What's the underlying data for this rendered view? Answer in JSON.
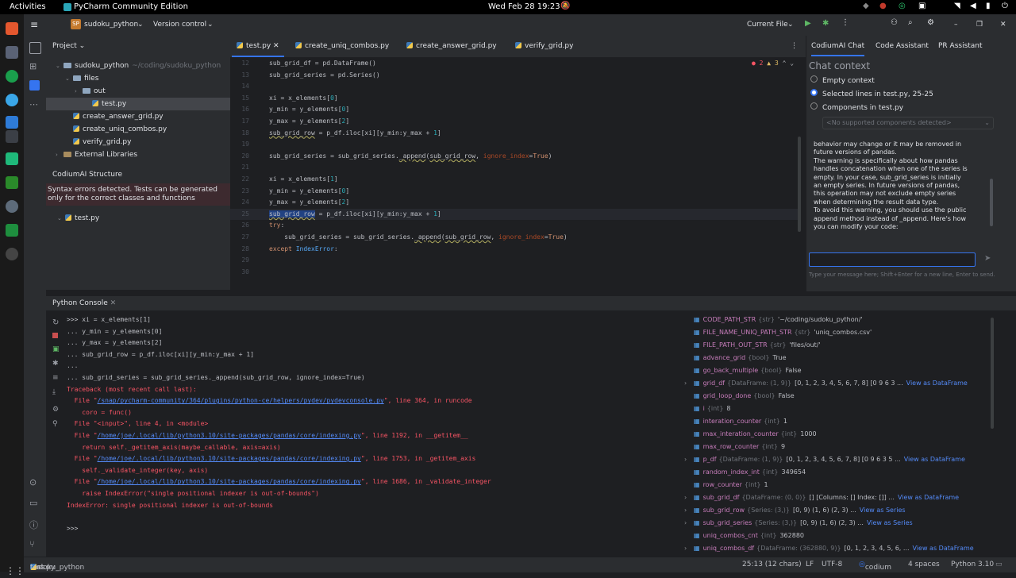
{
  "topbar": {
    "activities": "Activities",
    "app_name": "PyCharm Community Edition",
    "clock": "Wed Feb 28  19:23"
  },
  "dock_icons": [
    "brave-icon",
    "files-icon",
    "terminal-icon",
    "edge-icon",
    "vscode-icon",
    "code-icon",
    "pycharm-icon",
    "terminal2-icon",
    "spreadsheet-icon",
    "settings-icon",
    "more-apps-icon",
    "trash-icon"
  ],
  "toolbar": {
    "project_badge": "SP",
    "project_name": "sudoku_python",
    "vcs": "Version control",
    "run_config": "Current File"
  },
  "project": {
    "title": "Project",
    "tree": [
      {
        "label": "sudoku_python",
        "extra": "~/coding/sudoku_python",
        "indent": 0,
        "kind": "folder",
        "chev": "⌄"
      },
      {
        "label": "files",
        "indent": 1,
        "kind": "folder",
        "chev": "⌄"
      },
      {
        "label": "out",
        "indent": 2,
        "kind": "folder",
        "chev": "›"
      },
      {
        "label": "test.py",
        "indent": 3,
        "kind": "py",
        "selected": true
      },
      {
        "label": "create_answer_grid.py",
        "indent": 1,
        "kind": "py"
      },
      {
        "label": "create_uniq_combos.py",
        "indent": 1,
        "kind": "py"
      },
      {
        "label": "verify_grid.py",
        "indent": 1,
        "kind": "py"
      },
      {
        "label": "External Libraries",
        "indent": 0,
        "kind": "lib",
        "chev": "›"
      }
    ],
    "structure_title": "CodiumAI Structure",
    "structure_msg": "Syntax errors detected. Tests can be generated only for the correct classes and functions",
    "structure_file": "test.py"
  },
  "editor": {
    "tabs": [
      "test.py",
      "create_uniq_combos.py",
      "create_answer_grid.py",
      "verify_grid.py"
    ],
    "errors": "2",
    "warnings": "3",
    "lines": [
      {
        "n": "12",
        "html": "<span>sub_grid_df = pd.DataFrame()</span>"
      },
      {
        "n": "13",
        "html": "<span>sub_grid_series = pd.Series()</span>"
      },
      {
        "n": "14",
        "html": ""
      },
      {
        "n": "15",
        "html": "<span>xi = x_elements[<span class='num'>0</span>]</span>"
      },
      {
        "n": "16",
        "html": "<span>y_min = y_elements[<span class='num'>0</span>]</span>"
      },
      {
        "n": "17",
        "html": "<span>y_max = y_elements[<span class='num'>2</span>]</span>"
      },
      {
        "n": "18",
        "html": "<span class='warn'>sub_grid_row</span> = p_df.iloc[xi][y_min:y_max + <span class='num'>1</span>]"
      },
      {
        "n": "19",
        "html": ""
      },
      {
        "n": "20",
        "html": "sub_grid_series = sub_grid_series.<span class='warn'>_append</span>(<span class='warn'>sub_grid_row</span>, <span style='color:#aa4926'>ignore_index</span>=<span class='kw'>True</span>)"
      },
      {
        "n": "21",
        "html": ""
      },
      {
        "n": "22",
        "html": "xi = x_elements[<span class='num'>1</span>]"
      },
      {
        "n": "23",
        "html": "y_min = y_elements[<span class='num'>0</span>]"
      },
      {
        "n": "24",
        "html": "y_max = y_elements[<span class='num'>2</span>]"
      },
      {
        "n": "25",
        "html": "<span class='sel-hl warn'>sub_grid_row</span> = p_df.iloc[xi][y_min:y_max + <span class='num'>1</span>]",
        "current": true
      },
      {
        "n": "26",
        "html": "<span class='kw'>try</span>:"
      },
      {
        "n": "27",
        "html": "    sub_grid_series = sub_grid_series.<span class='warn'>_append</span>(<span class='warn'>sub_grid_row</span>, <span style='color:#aa4926'>ignore_index</span>=<span class='kw'>True</span>)"
      },
      {
        "n": "28",
        "html": "<span class='kw'>except</span> <span style='color:#56a8f5'>IndexError</span>:"
      },
      {
        "n": "29",
        "html": ""
      },
      {
        "n": "30",
        "html": ""
      }
    ]
  },
  "codium": {
    "tabs": [
      "CodiumAI Chat",
      "Code Assistant",
      "PR Assistant"
    ],
    "context_title": "Chat context",
    "options": [
      "Empty context",
      "Selected lines in test.py, 25-25",
      "Components in test.py"
    ],
    "selected_option": 1,
    "dropdown": "<No supported components detected>",
    "reply": [
      "behavior may change or it may be removed in",
      "future versions of pandas.",
      "The warning is specifically about how pandas",
      "handles concatenation when one of the series is",
      "empty. In your case, sub_grid_series is initially",
      "an empty series. In future versions of pandas,",
      "this operation may not exclude empty series",
      "when determining the result data type.",
      "To avoid this warning, you should use the public",
      "append method instead of _append. Here's how",
      "you can modify your code:"
    ],
    "input_hint": "Type your message here; Shift+Enter for a new line, Enter to send."
  },
  "console": {
    "title": "Python Console",
    "lines": [
      {
        "t": ">>> xi = x_elements[1]",
        "c": ""
      },
      {
        "t": "... y_min = y_elements[0]",
        "c": ""
      },
      {
        "t": "... y_max = y_elements[2]",
        "c": ""
      },
      {
        "t": "... sub_grid_row = p_df.iloc[xi][y_min:y_max + 1]",
        "c": ""
      },
      {
        "t": "...",
        "c": ""
      },
      {
        "t": "... sub_grid_series = sub_grid_series._append(sub_grid_row, ignore_index=True)",
        "c": ""
      },
      {
        "t": "Traceback (most recent call last):",
        "c": "err"
      },
      {
        "t": "  File \"",
        "link": "/snap/pycharm-community/364/plugins/python-ce/helpers/pydev/pydevconsole.py",
        "rest": "\", line 364, in runcode",
        "c": "err"
      },
      {
        "t": "    coro = func()",
        "c": "err"
      },
      {
        "t": "  File \"<input>\", line 4, in <module>",
        "c": "err"
      },
      {
        "t": "  File \"",
        "link": "/home/joe/.local/lib/python3.10/site-packages/pandas/core/indexing.py",
        "rest": "\", line 1192, in __getitem__",
        "c": "err"
      },
      {
        "t": "    return self._getitem_axis(maybe_callable, axis=axis)",
        "c": "err"
      },
      {
        "t": "  File \"",
        "link": "/home/joe/.local/lib/python3.10/site-packages/pandas/core/indexing.py",
        "rest": "\", line 1753, in _getitem_axis",
        "c": "err"
      },
      {
        "t": "    self._validate_integer(key, axis)",
        "c": "err"
      },
      {
        "t": "  File \"",
        "link": "/home/joe/.local/lib/python3.10/site-packages/pandas/core/indexing.py",
        "rest": "\", line 1686, in _validate_integer",
        "c": "err"
      },
      {
        "t": "    raise IndexError(\"single positional indexer is out-of-bounds\")",
        "c": "err"
      },
      {
        "t": "IndexError: single positional indexer is out-of-bounds",
        "c": "err"
      },
      {
        "t": "",
        "c": ""
      },
      {
        "t": ">>>",
        "c": ""
      }
    ]
  },
  "variables": [
    {
      "name": "CODE_PATH_STR",
      "type": "{str}",
      "value": "'~/coding/sudoku_python/'"
    },
    {
      "name": "FILE_NAME_UNIQ_PATH_STR",
      "type": "{str}",
      "value": "'uniq_combos.csv'"
    },
    {
      "name": "FILE_PATH_OUT_STR",
      "type": "{str}",
      "value": "'files/out/'"
    },
    {
      "name": "advance_grid",
      "type": "{bool}",
      "value": "True"
    },
    {
      "name": "go_back_multiple",
      "type": "{bool}",
      "value": "False"
    },
    {
      "name": "grid_df",
      "type": "{DataFrame: (1, 9)}",
      "value": "[0, 1, 2, 3, 4, 5, 6, 7, 8] [0  9  6  3 ...",
      "link": "View as DataFrame",
      "expand": true
    },
    {
      "name": "grid_loop_done",
      "type": "{bool}",
      "value": "False"
    },
    {
      "name": "i",
      "type": "{int}",
      "value": "8"
    },
    {
      "name": "interation_counter",
      "type": "{int}",
      "value": "1"
    },
    {
      "name": "max_interation_counter",
      "type": "{int}",
      "value": "1000"
    },
    {
      "name": "max_row_counter",
      "type": "{int}",
      "value": "9"
    },
    {
      "name": "p_df",
      "type": "{DataFrame: (1, 9)}",
      "value": "[0, 1, 2, 3, 4, 5, 6, 7, 8] [0  9  6  3  5 ...",
      "link": "View as DataFrame",
      "expand": true
    },
    {
      "name": "random_index_int",
      "type": "{int}",
      "value": "349654"
    },
    {
      "name": "row_counter",
      "type": "{int}",
      "value": "1"
    },
    {
      "name": "sub_grid_df",
      "type": "{DataFrame: (0, 0)}",
      "value": "[] [Columns: [] Index: []] ...",
      "link": "View as DataFrame",
      "expand": true
    },
    {
      "name": "sub_grid_row",
      "type": "{Series: (3,)}",
      "value": "[0, 9) (1, 6) (2, 3) ...",
      "link": "View as Series",
      "expand": true
    },
    {
      "name": "sub_grid_series",
      "type": "{Series: (3,)}",
      "value": "[0, 9) (1, 6) (2, 3) ...",
      "link": "View as Series",
      "expand": true
    },
    {
      "name": "uniq_combos_cnt",
      "type": "{int}",
      "value": "362880"
    },
    {
      "name": "uniq_combos_df",
      "type": "{DataFrame: (362880, 9)}",
      "value": "[0, 1, 2, 3, 4, 5, 6, ...",
      "link": "View as DataFrame",
      "expand": true
    }
  ],
  "status": {
    "breadcrumb": [
      "sudoku_python",
      "files",
      "test.py"
    ],
    "position": "25:13 (12 chars)",
    "line_sep": "LF",
    "encoding": "UTF-8",
    "plugin": "codium",
    "indent": "4 spaces",
    "interpreter": "Python 3.10"
  },
  "colors": {
    "accent": "#3574f0",
    "error": "#f75464",
    "link": "#548af7"
  }
}
